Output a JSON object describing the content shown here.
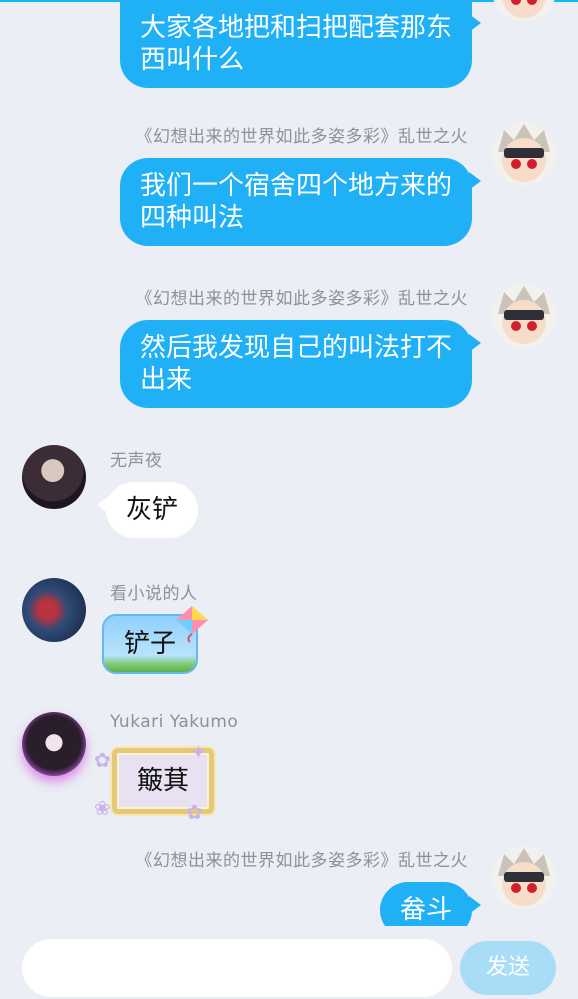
{
  "messages": [
    {
      "side": "me",
      "text_lines": [
        "大家各地把和扫把配套那东",
        "西叫什么"
      ]
    },
    {
      "side": "me",
      "sender": "《幻想出来的世界如此多姿多彩》乱世之火",
      "text_lines": [
        "我们一个宿舍四个地方来的",
        "四种叫法"
      ]
    },
    {
      "side": "me",
      "sender": "《幻想出来的世界如此多姿多彩》乱世之火",
      "text_lines": [
        "然后我发现自己的叫法打不",
        "出来"
      ]
    },
    {
      "side": "other",
      "sender": "无声夜",
      "text": "灰铲"
    },
    {
      "side": "other",
      "sender": "看小说的人",
      "text": "铲子"
    },
    {
      "side": "other",
      "sender": "Yukari Yakumo",
      "text": "簸萁"
    },
    {
      "side": "me",
      "sender": "《幻想出来的世界如此多姿多彩》乱世之火",
      "text": "畚斗"
    }
  ],
  "input": {
    "placeholder": "",
    "value": ""
  },
  "send_label": "发送",
  "colors": {
    "background": "#ebeef4",
    "my_bubble": "#20b0f5",
    "other_bubble": "#ffffff",
    "send_button": "#a8dcf7"
  }
}
